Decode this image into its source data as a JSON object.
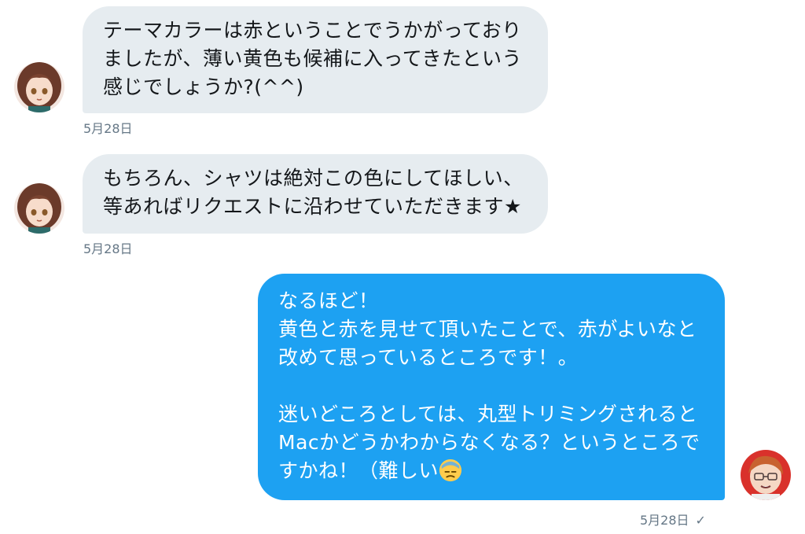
{
  "messages": [
    {
      "direction": "received",
      "lines": [
        "テーマカラーは赤ということでうかがっており",
        "ましたが、薄い黄色も候補に入ってきたという",
        "感じでしょうか?(^^)"
      ],
      "timestamp": "5月28日"
    },
    {
      "direction": "received",
      "lines": [
        "もちろん、シャツは絶対この色にしてほしい、",
        "等あればリクエストに沿わせていただきます★"
      ],
      "timestamp": "5月28日"
    },
    {
      "direction": "sent",
      "lines": [
        "なるほど！",
        "黄色と赤を見せて頂いたことで、赤がよいなと",
        "改めて思っているところです！。",
        "",
        "迷いどころとしては、丸型トリミングされると",
        "Macかどうかわからなくなる？というところで",
        "すかね！（難しい"
      ],
      "trailing_emoji": "downcast-sweat-face-emoji",
      "timestamp": "5月28日",
      "status": "✓"
    }
  ],
  "colors": {
    "received_bubble": "#e6ecf0",
    "sent_bubble": "#1da1f2",
    "timestamp": "#657786"
  }
}
